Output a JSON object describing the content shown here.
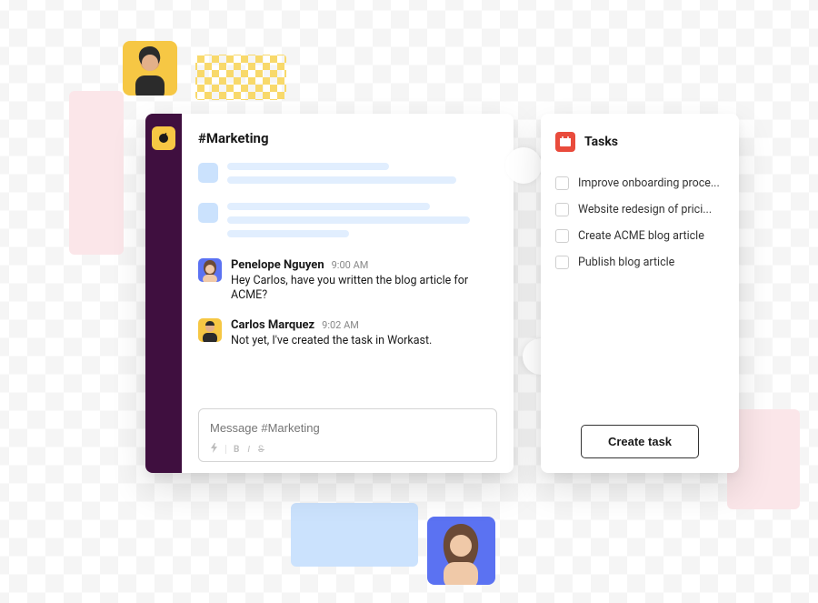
{
  "channel": {
    "name": "#Marketing"
  },
  "messages": [
    {
      "author": "Penelope Nguyen",
      "time": "9:00 AM",
      "text": "Hey Carlos, have you written the blog article for ACME?"
    },
    {
      "author": "Carlos Marquez",
      "time": "9:02 AM",
      "text": "Not yet, I've created the task in Workast."
    }
  ],
  "composer": {
    "placeholder": "Message #Marketing"
  },
  "tasks_panel": {
    "title": "Tasks",
    "items": [
      "Improve onboarding proce...",
      "Website redesign of prici...",
      "Create ACME blog article",
      "Publish blog article"
    ],
    "create_button": "Create task"
  }
}
